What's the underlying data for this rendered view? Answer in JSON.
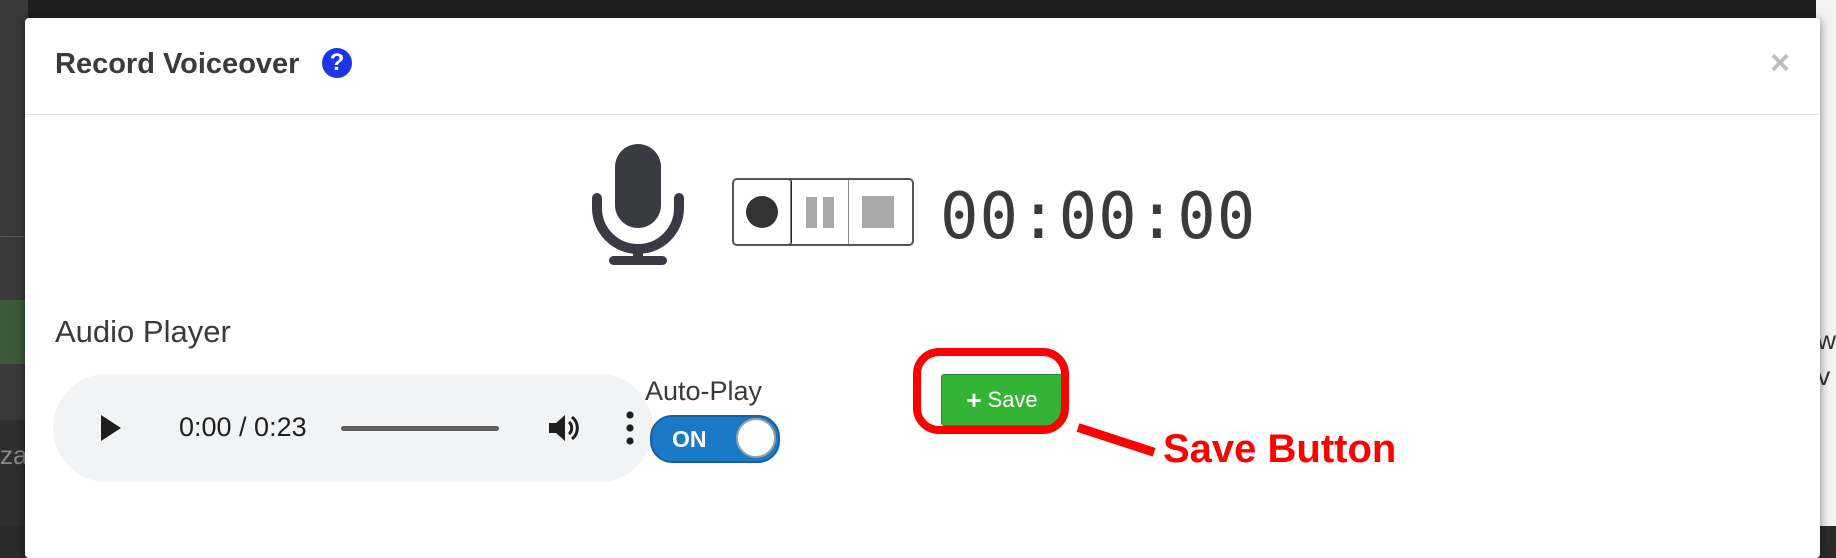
{
  "modal": {
    "title": "Record Voiceover",
    "help_icon": "question-circle-icon",
    "close_label": "×"
  },
  "recorder": {
    "timer": "00:00:00",
    "icons": [
      "microphone-icon",
      "record-icon",
      "pause-icon",
      "stop-icon"
    ]
  },
  "audio": {
    "section_label": "Audio Player",
    "time": "0:00 / 0:23",
    "progress": 0
  },
  "autoplay": {
    "label": "Auto-Play",
    "state": "ON"
  },
  "save": {
    "label": "Save",
    "icon_glyph": "+",
    "color": "#34b434"
  },
  "annotation": {
    "text": "Save Button",
    "color": "#ff0000"
  },
  "background": {
    "right_text": "w\nv",
    "left_text": "za"
  }
}
